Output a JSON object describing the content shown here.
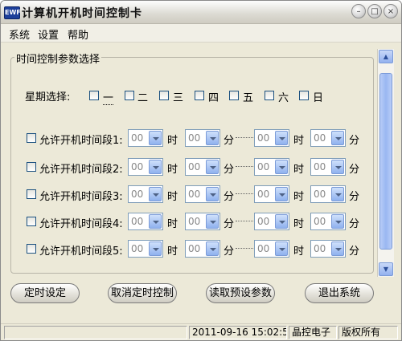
{
  "window": {
    "title": "计算机开机时间控制卡",
    "icon_name": "app-icon",
    "controls": [
      "minimize-icon",
      "maximize-icon",
      "close-icon"
    ]
  },
  "menu": {
    "items": [
      {
        "label": "系统"
      },
      {
        "label": "设置"
      },
      {
        "label": "帮助"
      }
    ]
  },
  "group": {
    "title": "时间控制参数选择",
    "weekday_label": "星期选择:",
    "weekdays": [
      {
        "label": "一",
        "checked": false
      },
      {
        "label": "二",
        "checked": false
      },
      {
        "label": "三",
        "checked": false
      },
      {
        "label": "四",
        "checked": false
      },
      {
        "label": "五",
        "checked": false
      },
      {
        "label": "六",
        "checked": false
      },
      {
        "label": "日",
        "checked": false
      }
    ],
    "periods": [
      {
        "label": "允许开机时间段1:",
        "checked": false,
        "start_hour": "00",
        "start_min": "00",
        "end_hour": "00",
        "end_min": "00"
      },
      {
        "label": "允许开机时间段2:",
        "checked": false,
        "start_hour": "00",
        "start_min": "00",
        "end_hour": "00",
        "end_min": "00"
      },
      {
        "label": "允许开机时间段3:",
        "checked": false,
        "start_hour": "00",
        "start_min": "00",
        "end_hour": "00",
        "end_min": "00"
      },
      {
        "label": "允许开机时间段4:",
        "checked": false,
        "start_hour": "00",
        "start_min": "00",
        "end_hour": "00",
        "end_min": "00"
      },
      {
        "label": "允许开机时间段5:",
        "checked": false,
        "start_hour": "00",
        "start_min": "00",
        "end_hour": "00",
        "end_min": "00"
      }
    ],
    "unit_hour": "时",
    "unit_minute": "分"
  },
  "buttons": {
    "set_timer": "定时设定",
    "cancel_timer": "取消定时控制",
    "read_preset": "读取预设参数",
    "exit": "退出系统"
  },
  "status": {
    "datetime": "2011-09-16 15:02:5",
    "company": "晶控电子",
    "rights": "版权所有"
  },
  "colors": {
    "window_bg": "#ece9d8",
    "checkbox_border": "#1c5180",
    "combo_button": "#8fb1ee",
    "scrollbar_thumb": "#9ab7f2"
  }
}
